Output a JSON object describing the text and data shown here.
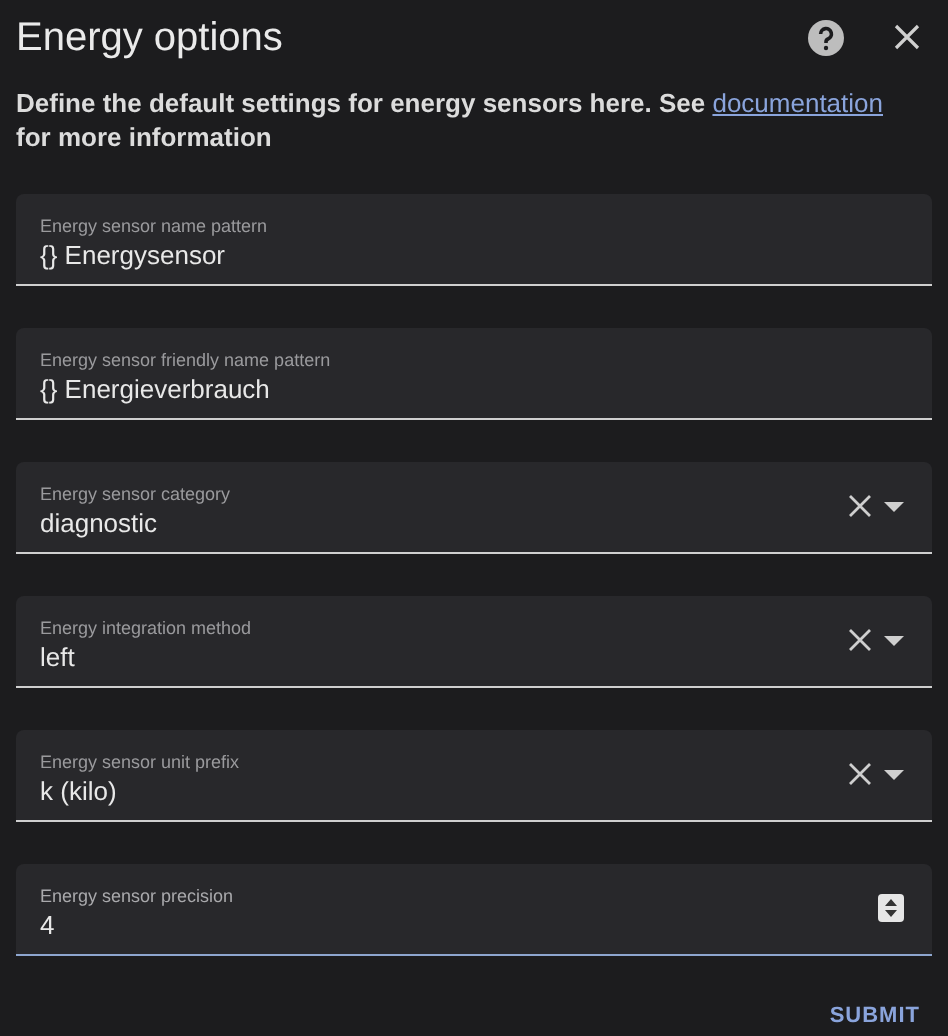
{
  "dialog": {
    "title": "Energy options"
  },
  "description": {
    "before": "Define the default settings for energy sensors here. See ",
    "link": "documentation",
    "after": " for more information"
  },
  "fields": [
    {
      "kind": "text",
      "label": "Energy sensor name pattern",
      "value": "{} Energysensor",
      "focused": false
    },
    {
      "kind": "text",
      "label": "Energy sensor friendly name pattern",
      "value": "{} Energieverbrauch",
      "focused": false
    },
    {
      "kind": "select",
      "label": "Energy sensor category",
      "value": "diagnostic",
      "focused": false
    },
    {
      "kind": "select",
      "label": "Energy integration method",
      "value": "left",
      "focused": false
    },
    {
      "kind": "select",
      "label": "Energy sensor unit prefix",
      "value": "k (kilo)",
      "focused": false
    },
    {
      "kind": "number",
      "label": "Energy sensor precision",
      "value": "4",
      "focused": true
    }
  ],
  "submit": "SUBMIT"
}
